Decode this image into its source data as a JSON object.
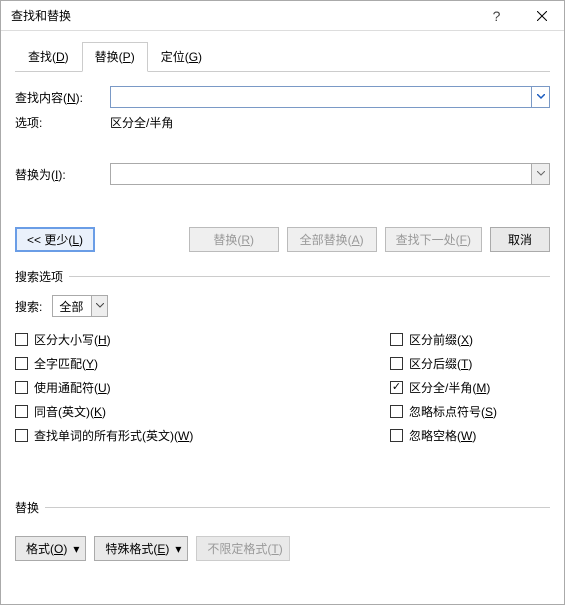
{
  "title": "查找和替换",
  "titlebar": {
    "help_tip": "?",
    "close_tip": "Close"
  },
  "tabs": {
    "find": {
      "label": "查找(",
      "key": "D",
      "suffix": ")"
    },
    "replace": {
      "label": "替换(",
      "key": "P",
      "suffix": ")"
    },
    "goto": {
      "label": "定位(",
      "key": "G",
      "suffix": ")"
    }
  },
  "fields": {
    "find_label_a": "查找内容(",
    "find_key": "N",
    "find_label_b": "):",
    "options_label": "选项:",
    "options_value": "区分全/半角",
    "replace_label_a": "替换为(",
    "replace_key": "I",
    "replace_label_b": "):"
  },
  "buttons": {
    "less_pre": "<< 更少(",
    "less_key": "L",
    "less_post": ")",
    "replace_pre": "替换(",
    "replace_key": "R",
    "replace_post": ")",
    "replace_all_pre": "全部替换(",
    "replace_all_key": "A",
    "replace_all_post": ")",
    "find_next_pre": "查找下一处(",
    "find_next_key": "F",
    "find_next_post": ")",
    "cancel": "取消"
  },
  "group_search": {
    "legend": "搜索选项",
    "search_label": "搜索:",
    "search_value": "全部",
    "left": [
      {
        "label_a": "区分大小写(",
        "key": "H",
        "label_b": ")",
        "checked": false
      },
      {
        "label_a": "全字匹配(",
        "key": "Y",
        "label_b": ")",
        "checked": false
      },
      {
        "label_a": "使用通配符(",
        "key": "U",
        "label_b": ")",
        "checked": false
      },
      {
        "label_a": "同音(英文)(",
        "key": "K",
        "label_b": ")",
        "checked": false
      },
      {
        "label_a": "查找单词的所有形式(英文)(",
        "key": "W",
        "label_b": ")",
        "checked": false
      }
    ],
    "right": [
      {
        "label_a": "区分前缀(",
        "key": "X",
        "label_b": ")",
        "checked": false
      },
      {
        "label_a": "区分后缀(",
        "key": "T",
        "label_b": ")",
        "checked": false
      },
      {
        "label_a": "区分全/半角(",
        "key": "M",
        "label_b": ")",
        "checked": true
      },
      {
        "label_a": "忽略标点符号(",
        "key": "S",
        "label_b": ")",
        "checked": false
      },
      {
        "label_a": "忽略空格(",
        "key": "W",
        "label_b": ")",
        "checked": false
      }
    ]
  },
  "group_replace": {
    "legend": "替换",
    "format_pre": "格式(",
    "format_key": "O",
    "format_post": ")",
    "special_pre": "特殊格式(",
    "special_key": "E",
    "special_post": ")",
    "nofmt_pre": "不限定格式(",
    "nofmt_key": "T",
    "nofmt_post": ")"
  }
}
